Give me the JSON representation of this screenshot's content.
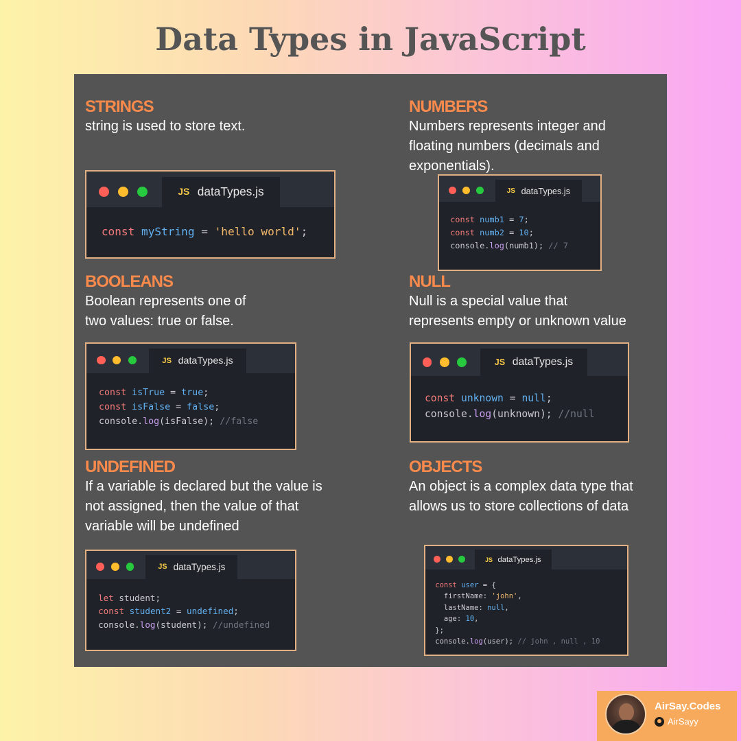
{
  "title": "Data Types in JavaScript",
  "sections": {
    "strings": {
      "heading": "STRINGS",
      "description": "string is used to store text.",
      "file_name": "dataTypes.js",
      "code": [
        [
          [
            "kw",
            "const"
          ],
          [
            "plain",
            " "
          ],
          [
            "var",
            "myString"
          ],
          [
            "plain",
            " = "
          ],
          [
            "str",
            "'hello world'"
          ],
          [
            "plain",
            ";"
          ]
        ]
      ]
    },
    "numbers": {
      "heading": "NUMBERS",
      "description": "Numbers represents integer and\nfloating numbers (decimals and\nexponentials).",
      "file_name": "dataTypes.js",
      "code": [
        [
          [
            "kw",
            "const"
          ],
          [
            "plain",
            " "
          ],
          [
            "var",
            "numb1"
          ],
          [
            "plain",
            " = "
          ],
          [
            "num",
            "7"
          ],
          [
            "plain",
            ";"
          ]
        ],
        [
          [
            "kw",
            "const"
          ],
          [
            "plain",
            " "
          ],
          [
            "var",
            "numb2"
          ],
          [
            "plain",
            " = "
          ],
          [
            "num",
            "10"
          ],
          [
            "plain",
            ";"
          ]
        ],
        [
          [
            "plain",
            "console."
          ],
          [
            "fn",
            "log"
          ],
          [
            "plain",
            "(numb1); "
          ],
          [
            "cm",
            "// 7"
          ]
        ]
      ]
    },
    "booleans": {
      "heading": "BOOLEANS",
      "description": "Boolean represents one of\ntwo values: true or false.",
      "file_name": "dataTypes.js",
      "code": [
        [
          [
            "kw",
            "const"
          ],
          [
            "plain",
            " "
          ],
          [
            "var",
            "isTrue"
          ],
          [
            "plain",
            " = "
          ],
          [
            "num",
            "true"
          ],
          [
            "plain",
            ";"
          ]
        ],
        [
          [
            "kw",
            "const"
          ],
          [
            "plain",
            " "
          ],
          [
            "var",
            "isFalse"
          ],
          [
            "plain",
            " = "
          ],
          [
            "num",
            "false"
          ],
          [
            "plain",
            ";"
          ]
        ],
        [
          [
            "plain",
            "console."
          ],
          [
            "fn",
            "log"
          ],
          [
            "plain",
            "(isFalse); "
          ],
          [
            "cm",
            "//false"
          ]
        ]
      ]
    },
    "null": {
      "heading": "NULL",
      "description": "Null is a special value that\nrepresents empty or unknown value",
      "file_name": "dataTypes.js",
      "code": [
        [
          [
            "kw",
            "const"
          ],
          [
            "plain",
            " "
          ],
          [
            "var",
            "unknown"
          ],
          [
            "plain",
            " = "
          ],
          [
            "num",
            "null"
          ],
          [
            "plain",
            ";"
          ]
        ],
        [
          [
            "plain",
            "console."
          ],
          [
            "fn",
            "log"
          ],
          [
            "plain",
            "(unknown); "
          ],
          [
            "cm",
            "//null"
          ]
        ]
      ]
    },
    "undefined": {
      "heading": "UNDEFINED",
      "description": " If a variable is declared but the value is\nnot assigned, then the value of that\nvariable will be undefined",
      "file_name": "dataTypes.js",
      "code": [
        [
          [
            "kw",
            "let"
          ],
          [
            "plain",
            " student;"
          ]
        ],
        [
          [
            "kw",
            "const"
          ],
          [
            "plain",
            " "
          ],
          [
            "var",
            "student2"
          ],
          [
            "plain",
            " = "
          ],
          [
            "num",
            "undefined"
          ],
          [
            "plain",
            ";"
          ]
        ],
        [
          [
            "plain",
            "console."
          ],
          [
            "fn",
            "log"
          ],
          [
            "plain",
            "(student); "
          ],
          [
            "cm",
            "//undefined"
          ]
        ]
      ]
    },
    "objects": {
      "heading": "OBJECTS",
      "description": "An object is a complex data type that\nallows us to store collections of data",
      "file_name": "dataTypes.js",
      "code": [
        [
          [
            "kw",
            "const"
          ],
          [
            "plain",
            " "
          ],
          [
            "var",
            "user"
          ],
          [
            "plain",
            " = {"
          ]
        ],
        [
          [
            "plain",
            "  firstName: "
          ],
          [
            "str",
            "'john'"
          ],
          [
            "plain",
            ","
          ]
        ],
        [
          [
            "plain",
            "  lastName: "
          ],
          [
            "num",
            "null"
          ],
          [
            "plain",
            ","
          ]
        ],
        [
          [
            "plain",
            "  age: "
          ],
          [
            "num",
            "10"
          ],
          [
            "plain",
            ","
          ]
        ],
        [
          [
            "plain",
            "};"
          ]
        ],
        [
          [
            "plain",
            "console."
          ],
          [
            "fn",
            "log"
          ],
          [
            "plain",
            "(user); "
          ],
          [
            "cm",
            "// john , null , 10"
          ]
        ]
      ]
    }
  },
  "brand": {
    "name": "AirSay.Codes",
    "handle": "AirSayy",
    "github_icon": "github-icon"
  }
}
